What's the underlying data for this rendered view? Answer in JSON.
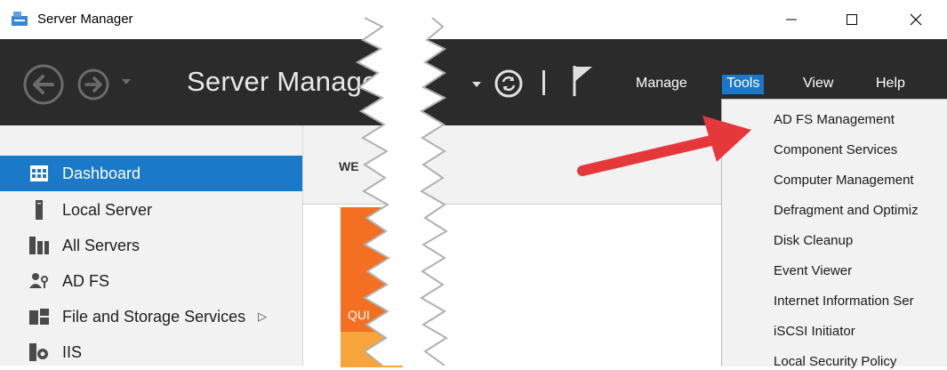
{
  "window": {
    "title": "Server Manager",
    "icon": "server-manager-icon"
  },
  "header": {
    "app_title": "Server Manager",
    "menu": {
      "manage": "Manage",
      "tools": "Tools",
      "view": "View",
      "help": "Help"
    }
  },
  "sidebar": {
    "items": [
      {
        "label": "Dashboard",
        "icon": "dashboard-icon",
        "active": true
      },
      {
        "label": "Local Server",
        "icon": "local-server-icon"
      },
      {
        "label": "All Servers",
        "icon": "all-servers-icon"
      },
      {
        "label": "AD FS",
        "icon": "ad-fs-icon"
      },
      {
        "label": "File and Storage Services",
        "icon": "file-storage-icon",
        "has_submenu": true
      },
      {
        "label": "IIS",
        "icon": "iis-icon"
      }
    ]
  },
  "main": {
    "welcome": "WE",
    "quick": "QUI"
  },
  "tools_menu": {
    "items": [
      "AD FS Management",
      "Component Services",
      "Computer Management",
      "Defragment and Optimiz",
      "Disk Cleanup",
      "Event Viewer",
      "Internet Information Ser",
      "iSCSI Initiator",
      "Local Security Policy"
    ]
  },
  "colors": {
    "header_bg": "#2b2b2b",
    "accent": "#1a79c9",
    "arrow": "#e5383b",
    "tile_orange": "#f36f21"
  }
}
